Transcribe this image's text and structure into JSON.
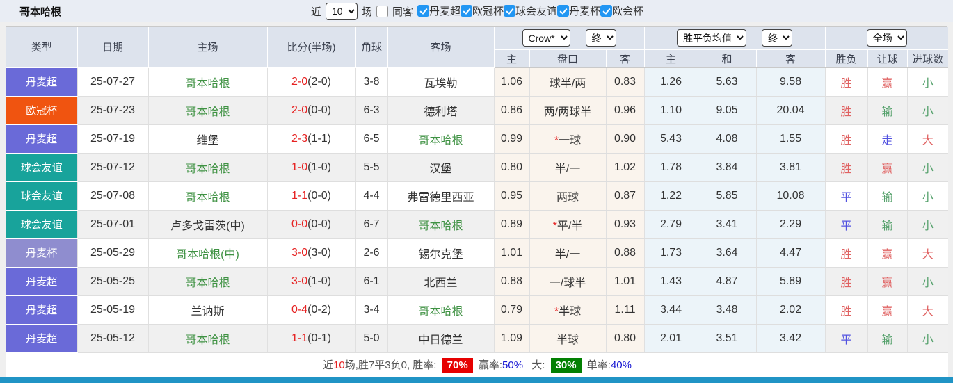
{
  "header": {
    "team_title": "哥本哈根",
    "recent_label": "近",
    "recent_value": "10",
    "matches_label": "场",
    "same_opponent_label": "同客",
    "same_opponent_checked": false,
    "leagues": [
      {
        "label": "丹麦超",
        "checked": true
      },
      {
        "label": "欧冠杯",
        "checked": true
      },
      {
        "label": "球会友谊",
        "checked": true
      },
      {
        "label": "丹麦杯",
        "checked": true
      },
      {
        "label": "欧会杯",
        "checked": true
      }
    ]
  },
  "table": {
    "main_headers": [
      "类型",
      "日期",
      "主场",
      "比分(半场)",
      "角球",
      "客场"
    ],
    "sub_headers": [
      "主",
      "盘口",
      "客",
      "主",
      "和",
      "客",
      "胜负",
      "让球",
      "进球数"
    ],
    "dropdowns": {
      "odds_source": "Crow*",
      "odds_time": "终",
      "avg_type": "胜平负均值",
      "avg_time": "终",
      "scope": "全场"
    },
    "rows": [
      {
        "type": "丹麦超",
        "date": "25-07-27",
        "home": "哥本哈根",
        "home_green": true,
        "score": "2-0",
        "half": "(2-0)",
        "corner": "3-8",
        "away": "瓦埃勒",
        "away_green": false,
        "odds_home": "1.06",
        "handicap": "球半/两",
        "star": false,
        "odds_away": "0.83",
        "avg_win": "1.26",
        "avg_draw": "5.63",
        "avg_lose": "9.58",
        "result": "胜",
        "handicap_result": "赢",
        "goals": "小"
      },
      {
        "type": "欧冠杯",
        "date": "25-07-23",
        "home": "哥本哈根",
        "home_green": true,
        "score": "2-0",
        "half": "(0-0)",
        "corner": "6-3",
        "away": "德利塔",
        "away_green": false,
        "odds_home": "0.86",
        "handicap": "两/两球半",
        "star": false,
        "odds_away": "0.96",
        "avg_win": "1.10",
        "avg_draw": "9.05",
        "avg_lose": "20.04",
        "result": "胜",
        "handicap_result": "输",
        "goals": "小"
      },
      {
        "type": "丹麦超",
        "date": "25-07-19",
        "home": "维堡",
        "home_green": false,
        "score": "2-3",
        "half": "(1-1)",
        "corner": "6-5",
        "away": "哥本哈根",
        "away_green": true,
        "odds_home": "0.99",
        "handicap": "一球",
        "star": true,
        "odds_away": "0.90",
        "avg_win": "5.43",
        "avg_draw": "4.08",
        "avg_lose": "1.55",
        "result": "胜",
        "handicap_result": "走",
        "goals": "大"
      },
      {
        "type": "球会友谊",
        "date": "25-07-12",
        "home": "哥本哈根",
        "home_green": true,
        "score": "1-0",
        "half": "(1-0)",
        "corner": "5-5",
        "away": "汉堡",
        "away_green": false,
        "odds_home": "0.80",
        "handicap": "半/一",
        "star": false,
        "odds_away": "1.02",
        "avg_win": "1.78",
        "avg_draw": "3.84",
        "avg_lose": "3.81",
        "result": "胜",
        "handicap_result": "赢",
        "goals": "小"
      },
      {
        "type": "球会友谊",
        "date": "25-07-08",
        "home": "哥本哈根",
        "home_green": true,
        "score": "1-1",
        "half": "(0-0)",
        "corner": "4-4",
        "away": "弗雷德里西亚",
        "away_green": false,
        "odds_home": "0.95",
        "handicap": "两球",
        "star": false,
        "odds_away": "0.87",
        "avg_win": "1.22",
        "avg_draw": "5.85",
        "avg_lose": "10.08",
        "result": "平",
        "handicap_result": "输",
        "goals": "小"
      },
      {
        "type": "球会友谊",
        "date": "25-07-01",
        "home": "卢多戈雷茨(中)",
        "home_green": false,
        "score": "0-0",
        "half": "(0-0)",
        "corner": "6-7",
        "away": "哥本哈根",
        "away_green": true,
        "odds_home": "0.89",
        "handicap": "平/半",
        "star": true,
        "odds_away": "0.93",
        "avg_win": "2.79",
        "avg_draw": "3.41",
        "avg_lose": "2.29",
        "result": "平",
        "handicap_result": "输",
        "goals": "小"
      },
      {
        "type": "丹麦杯",
        "date": "25-05-29",
        "home": "哥本哈根(中)",
        "home_green": true,
        "score": "3-0",
        "half": "(3-0)",
        "corner": "2-6",
        "away": "锡尔克堡",
        "away_green": false,
        "odds_home": "1.01",
        "handicap": "半/一",
        "star": false,
        "odds_away": "0.88",
        "avg_win": "1.73",
        "avg_draw": "3.64",
        "avg_lose": "4.47",
        "result": "胜",
        "handicap_result": "赢",
        "goals": "大"
      },
      {
        "type": "丹麦超",
        "date": "25-05-25",
        "home": "哥本哈根",
        "home_green": true,
        "score": "3-0",
        "half": "(1-0)",
        "corner": "6-1",
        "away": "北西兰",
        "away_green": false,
        "odds_home": "0.88",
        "handicap": "一/球半",
        "star": false,
        "odds_away": "1.01",
        "avg_win": "1.43",
        "avg_draw": "4.87",
        "avg_lose": "5.89",
        "result": "胜",
        "handicap_result": "赢",
        "goals": "小"
      },
      {
        "type": "丹麦超",
        "date": "25-05-19",
        "home": "兰讷斯",
        "home_green": false,
        "score": "0-4",
        "half": "(0-2)",
        "corner": "3-4",
        "away": "哥本哈根",
        "away_green": true,
        "odds_home": "0.79",
        "handicap": "半球",
        "star": true,
        "odds_away": "1.11",
        "avg_win": "3.44",
        "avg_draw": "3.48",
        "avg_lose": "2.02",
        "result": "胜",
        "handicap_result": "赢",
        "goals": "大"
      },
      {
        "type": "丹麦超",
        "date": "25-05-12",
        "home": "哥本哈根",
        "home_green": true,
        "score": "1-1",
        "half": "(0-1)",
        "corner": "5-0",
        "away": "中日德兰",
        "away_green": false,
        "odds_home": "1.09",
        "handicap": "半球",
        "star": false,
        "odds_away": "0.80",
        "avg_win": "2.01",
        "avg_draw": "3.51",
        "avg_lose": "3.42",
        "result": "平",
        "handicap_result": "输",
        "goals": "小"
      }
    ]
  },
  "colors": {
    "types": {
      "丹麦超": "#6a6ad8",
      "欧冠杯": "#f05410",
      "球会友谊": "#18a39b",
      "丹麦杯": "#8f8dcf"
    },
    "result": {
      "胜": "#e06363",
      "平": "#5252e0",
      "负": "#53a06a"
    },
    "handicap_result": {
      "赢": "#e06363",
      "输": "#53a06a",
      "走": "#5252e0"
    },
    "goals": {
      "大": "#e06363",
      "小": "#53a06a"
    },
    "score_red": "#e62222",
    "team_green": "#3f9243",
    "accent_bar": "#2094c5"
  },
  "footer": {
    "near_label": "近",
    "count": "10",
    "summary": "场,胜7平3负0, 胜率:",
    "win_rate": "70%",
    "win_odds_label": "赢率:",
    "win_odds_value": "50%",
    "big_label": "大:",
    "big_value": "30%",
    "single_label": "单率:",
    "single_value": "40%"
  }
}
